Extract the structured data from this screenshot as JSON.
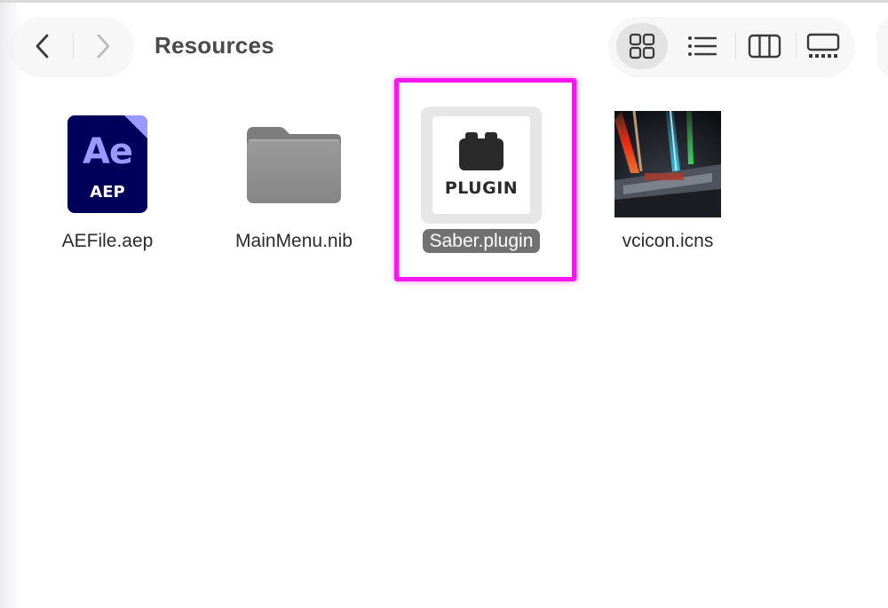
{
  "window": {
    "title": "Resources"
  },
  "toolbar": {
    "back_icon": "chevron-left-icon",
    "forward_icon": "chevron-right-icon",
    "views": [
      {
        "name": "icon-view",
        "icon": "grid-icon",
        "active": true
      },
      {
        "name": "list-view",
        "icon": "list-icon",
        "active": false
      },
      {
        "name": "column-view",
        "icon": "columns-icon",
        "active": false
      },
      {
        "name": "gallery-view",
        "icon": "gallery-icon",
        "active": false
      }
    ]
  },
  "files": [
    {
      "name": "AEFile.aep",
      "icon": "after-effects-project-icon",
      "badge_logo": "Ae",
      "badge_ext": "AEP"
    },
    {
      "name": "MainMenu.nib",
      "icon": "folder-icon"
    },
    {
      "name": "Saber.plugin",
      "icon": "plugin-icon",
      "badge_text": "PLUGIN",
      "selected": true
    },
    {
      "name": "vcicon.icns",
      "icon": "lightsaber-thumbnail-icon"
    }
  ],
  "colors": {
    "highlight": "#f516f0",
    "selection_label": "#717171",
    "ae_background": "#00005b",
    "ae_accent": "#9999ff",
    "folder": "#8e8e8e"
  }
}
